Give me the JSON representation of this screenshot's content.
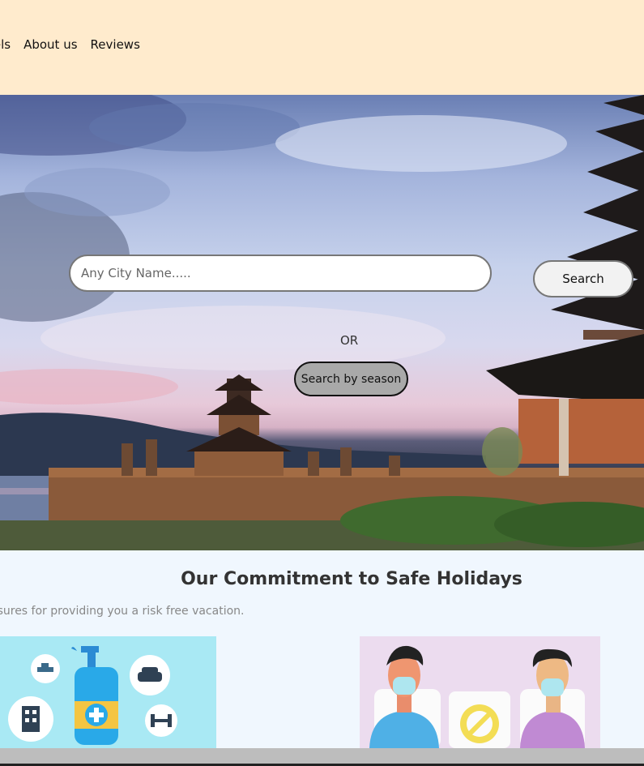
{
  "nav": {
    "items": [
      {
        "label": "Hotels",
        "visible_label": "tels"
      },
      {
        "label": "About us"
      },
      {
        "label": "Reviews"
      }
    ]
  },
  "hero": {
    "search_placeholder": "Any City Name.....",
    "search_button": "Search",
    "or_text": "OR",
    "season_button": "Search by season"
  },
  "commitment": {
    "title": "Our Commitment to Safe Holidays",
    "subtitle": "asures for providing you a risk free vacation."
  },
  "colors": {
    "header_bg": "#ffebcd",
    "page_bg": "#f0f7fe",
    "card1_bg": "#a9e9f4",
    "card2_bg": "#ecdcef"
  }
}
